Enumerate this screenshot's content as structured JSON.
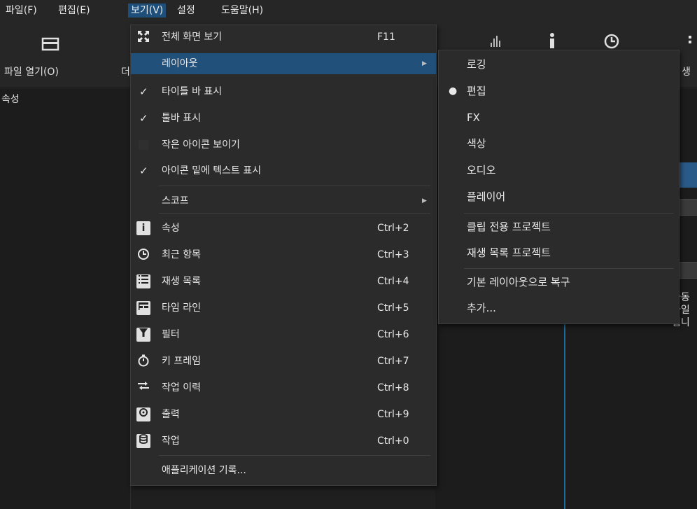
{
  "menubar": {
    "items": [
      {
        "label": "파일(F)"
      },
      {
        "label": "편집(E)"
      },
      {
        "label": "보기(V)"
      },
      {
        "label": "설정"
      },
      {
        "label": "도움말(H)"
      }
    ]
  },
  "toolbar": {
    "open_label": "파일 열기(O)",
    "cut_label": "더",
    "right_label": "생"
  },
  "left_panel": {
    "title": "속성"
  },
  "background_fragments": [
    "자동",
    "파일",
    "됩니"
  ],
  "view_menu": {
    "fullscreen": {
      "label": "전체 화면 보기",
      "shortcut": "F11"
    },
    "layout": {
      "label": "레이아웃"
    },
    "title_bar": {
      "label": "타이틀 바 표시",
      "checked": true
    },
    "toolbar": {
      "label": "툴바 표시",
      "checked": true
    },
    "small_icons": {
      "label": "작은 아이콘 보이기",
      "checked": false
    },
    "text_under_icons": {
      "label": "아이콘 밑에 텍스트 표시",
      "checked": true
    },
    "scope": {
      "label": "스코프"
    },
    "properties": {
      "label": "속성",
      "shortcut": "Ctrl+2"
    },
    "recent": {
      "label": "최근 항목",
      "shortcut": "Ctrl+3"
    },
    "playlist": {
      "label": "재생 목록",
      "shortcut": "Ctrl+4"
    },
    "timeline": {
      "label": "타임 라인",
      "shortcut": "Ctrl+5"
    },
    "filters": {
      "label": "필터",
      "shortcut": "Ctrl+6"
    },
    "keyframes": {
      "label": "키 프레임",
      "shortcut": "Ctrl+7"
    },
    "history": {
      "label": "작업 이력",
      "shortcut": "Ctrl+8"
    },
    "export": {
      "label": "출력",
      "shortcut": "Ctrl+9"
    },
    "jobs": {
      "label": "작업",
      "shortcut": "Ctrl+0"
    },
    "app_log": {
      "label": "애플리케이션 기록..."
    }
  },
  "layout_submenu": {
    "items": [
      {
        "label": "로깅",
        "selected": false
      },
      {
        "label": "편집",
        "selected": true
      },
      {
        "label": "FX",
        "selected": false
      },
      {
        "label": "색상",
        "selected": false
      },
      {
        "label": "오디오",
        "selected": false
      },
      {
        "label": "플레이어",
        "selected": false
      },
      {
        "label": "클립 전용 프로젝트",
        "selected": false
      },
      {
        "label": "재생 목록 프로젝트",
        "selected": false
      },
      {
        "label": "기본 레이아웃으로 복구",
        "selected": false
      },
      {
        "label": "추가...",
        "selected": false
      }
    ]
  },
  "colors": {
    "highlight": "#21507a",
    "menu_bg": "#2b2b2b",
    "window_bg": "#1f1f1f",
    "timeline_line": "#1b6da0"
  }
}
